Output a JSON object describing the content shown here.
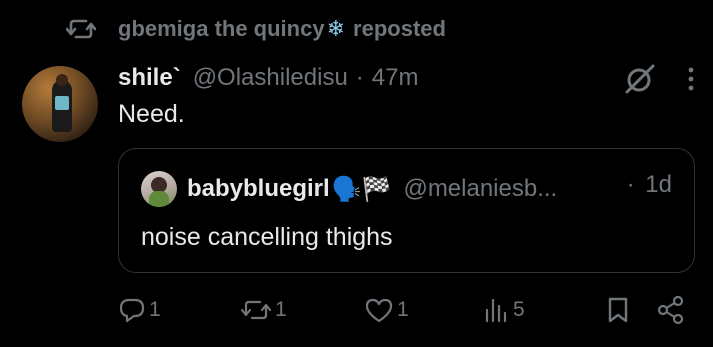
{
  "repost_banner": {
    "reposter_name": "gbemiga the quincy",
    "snowflake_icon": "❄",
    "suffix": "reposted"
  },
  "tweet": {
    "author_name": "shile`",
    "handle": "@Olashiledisu",
    "separator": "·",
    "timestamp": "47m",
    "text": "Need."
  },
  "quoted_tweet": {
    "author_name": "babybluegirl",
    "emoji": "🗣️🏁",
    "handle": "@melaniesb...",
    "separator": "·",
    "timestamp": "1d",
    "text": "noise cancelling thighs"
  },
  "actions": {
    "replies": "1",
    "reposts": "1",
    "likes": "1",
    "views": "5"
  },
  "colors": {
    "background": "#000000",
    "text_primary": "#e7e9ea",
    "text_secondary": "#71767b",
    "border": "#2f3336"
  },
  "icons": {
    "repost": "repost-icon",
    "grok": "grok-icon",
    "more": "more-icon",
    "reply": "reply-icon",
    "like": "like-icon",
    "views": "views-icon",
    "bookmark": "bookmark-icon",
    "share": "share-icon"
  }
}
